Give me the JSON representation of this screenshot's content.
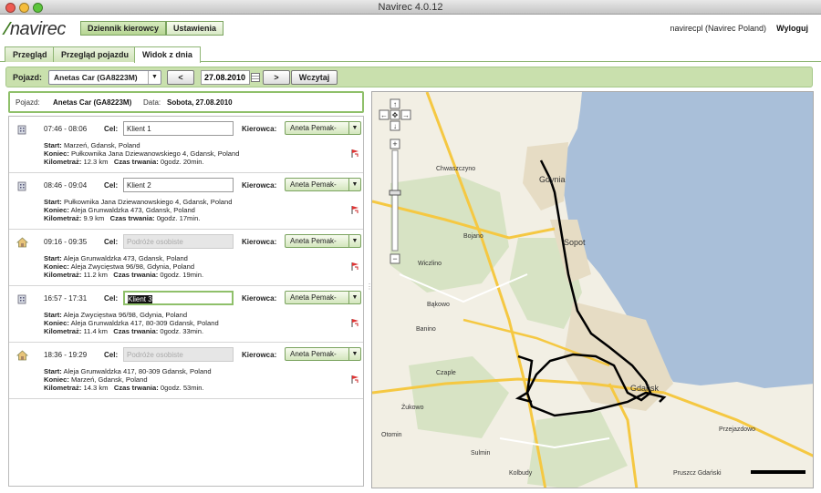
{
  "window": {
    "title": "Navirec 4.0.12"
  },
  "header": {
    "logo": "navirec",
    "nav": [
      "Dziennik kierowcy",
      "Ustawienia"
    ],
    "user": "navirecpl (Navirec Poland)",
    "logout": "Wyloguj"
  },
  "tabs": [
    "Przegląd",
    "Przegląd pojazdu",
    "Widok z dnia"
  ],
  "toolbar": {
    "vehicle_label": "Pojazd:",
    "vehicle_value": "Anetas Car (GA8223M)",
    "prev": "<",
    "date": "27.08.2010",
    "next": ">",
    "load": "Wczytaj"
  },
  "info": {
    "vehicle_label": "Pojazd:",
    "vehicle": "Anetas Car (GA8223M)",
    "date_label": "Data:",
    "date": "Sobota, 27.08.2010"
  },
  "labels": {
    "cel": "Cel:",
    "kierowca": "Kierowca:",
    "start": "Start:",
    "koniec": "Koniec:",
    "km": "Kilometraż:",
    "czas": "Czas trwania:"
  },
  "trips": [
    {
      "time": "07:46 - 08:06",
      "cel": "Klient 1",
      "type": "business",
      "kierowca": "Aneta Pemak-",
      "start": "Marzeń, Gdansk, Poland",
      "koniec": "Pułkownika Jana Dziewanowskiego 4, Gdansk, Poland",
      "km": "12.3 km",
      "czas": "0godz. 20min."
    },
    {
      "time": "08:46 - 09:04",
      "cel": "Klient 2",
      "type": "business",
      "kierowca": "Aneta Pemak-",
      "start": "Pułkownika Jana Dziewanowskiego 4, Gdansk, Poland",
      "koniec": "Aleja Grunwaldzka 473, Gdansk, Poland",
      "km": "9.9 km",
      "czas": "0godz. 17min."
    },
    {
      "time": "09:16 - 09:35",
      "cel": "Podróże osobiste",
      "type": "private",
      "kierowca": "Aneta Pemak-",
      "start": "Aleja Grunwaldzka 473, Gdansk, Poland",
      "koniec": "Aleja Zwycięstwa 96/98, Gdynia, Poland",
      "km": "11.2 km",
      "czas": "0godz. 19min."
    },
    {
      "time": "16:57 - 17:31",
      "cel": "Klient 3",
      "type": "business-focused",
      "kierowca": "Aneta Pemak-",
      "start": "Aleja Zwycięstwa 96/98, Gdynia, Poland",
      "koniec": "Aleja Grunwaldzka 417, 80-309 Gdansk, Poland",
      "km": "11.4 km",
      "czas": "0godz. 33min."
    },
    {
      "time": "18:36 - 19:29",
      "cel": "Podróże osobiste",
      "type": "private",
      "kierowca": "Aneta Pemak-",
      "start": "Aleja Grunwaldzka 417, 80-309 Gdansk, Poland",
      "koniec": "Marzeń, Gdansk, Poland",
      "km": "14.3 km",
      "czas": "0godz. 53min."
    }
  ],
  "map": {
    "labels": [
      "Gdynia",
      "Sopot",
      "Gdańsk",
      "Chwaszczyno",
      "Bojano",
      "Czaple",
      "Banino",
      "Żukowo",
      "Kolbudy",
      "Pruszcz Gdański",
      "Przejazdowo",
      "Wiczlino",
      "Bąkowo",
      "Sulmin",
      "Otomin"
    ],
    "water_color": "#a9bfd9",
    "land_color": "#f2efe4",
    "route_color": "#000000"
  }
}
